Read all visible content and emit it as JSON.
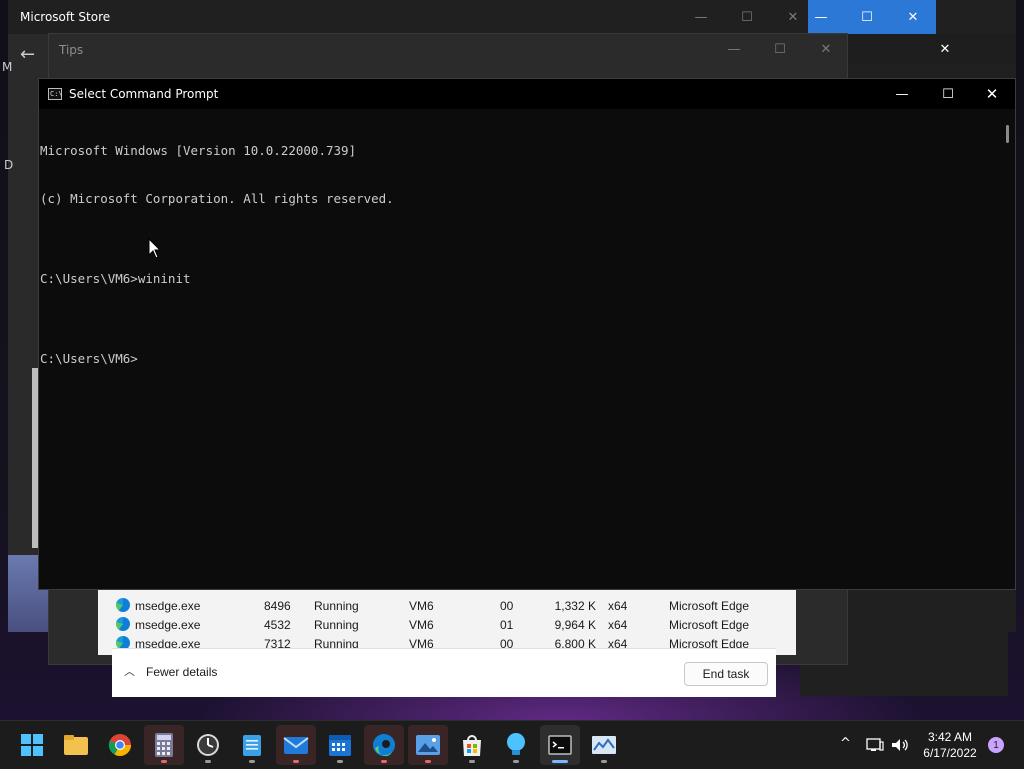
{
  "windows": {
    "store": {
      "title": "Microsoft Store",
      "side_text_1": "M",
      "side_text_2": "D"
    },
    "tips": {
      "title": "Tips"
    },
    "cmd": {
      "title": "Select Command Prompt",
      "icon_text": "C:\\",
      "lines": [
        "Microsoft Windows [Version 10.0.22000.739]",
        "(c) Microsoft Corporation. All rights reserved.",
        "",
        "C:\\Users\\VM6>wininit",
        "",
        "C:\\Users\\VM6>"
      ]
    },
    "taskmgr": {
      "rows": [
        {
          "name": "msedge.exe",
          "pid": "8496",
          "status": "Running",
          "user": "VM6",
          "cpu": "00",
          "mem": "1,332 K",
          "arch": "x64",
          "desc": "Microsoft Edge"
        },
        {
          "name": "msedge.exe",
          "pid": "4532",
          "status": "Running",
          "user": "VM6",
          "cpu": "01",
          "mem": "9,964 K",
          "arch": "x64",
          "desc": "Microsoft Edge"
        },
        {
          "name": "msedge.exe",
          "pid": "7312",
          "status": "Running",
          "user": "VM6",
          "cpu": "00",
          "mem": "6,800 K",
          "arch": "x64",
          "desc": "Microsoft Edge"
        }
      ],
      "fewer_details": "Fewer details",
      "end_task": "End task"
    }
  },
  "caption": {
    "minimize": "—",
    "maximize": "☐",
    "close": "✕"
  },
  "taskbar": {
    "apps": [
      {
        "name": "start",
        "icon": "windows-logo-icon"
      },
      {
        "name": "file-explorer",
        "icon": "folder-icon"
      },
      {
        "name": "chrome",
        "icon": "chrome-icon"
      },
      {
        "name": "calculator",
        "icon": "calculator-icon"
      },
      {
        "name": "clock",
        "icon": "clock-icon"
      },
      {
        "name": "notepad",
        "icon": "notepad-icon"
      },
      {
        "name": "mail",
        "icon": "mail-icon"
      },
      {
        "name": "calendar",
        "icon": "calendar-icon"
      },
      {
        "name": "edge",
        "icon": "edge-icon"
      },
      {
        "name": "photos",
        "icon": "photos-icon"
      },
      {
        "name": "store",
        "icon": "store-icon"
      },
      {
        "name": "tips",
        "icon": "lightbulb-icon"
      },
      {
        "name": "terminal",
        "icon": "terminal-icon"
      },
      {
        "name": "task-manager",
        "icon": "task-manager-icon"
      }
    ],
    "tray": {
      "chevron": "^",
      "time": "3:42 AM",
      "date": "6/17/2022",
      "notifications": "1"
    }
  },
  "colors": {
    "cmd_bg": "#0c0c0c",
    "console_text": "#cccccc",
    "accent": "#2b78d6"
  }
}
